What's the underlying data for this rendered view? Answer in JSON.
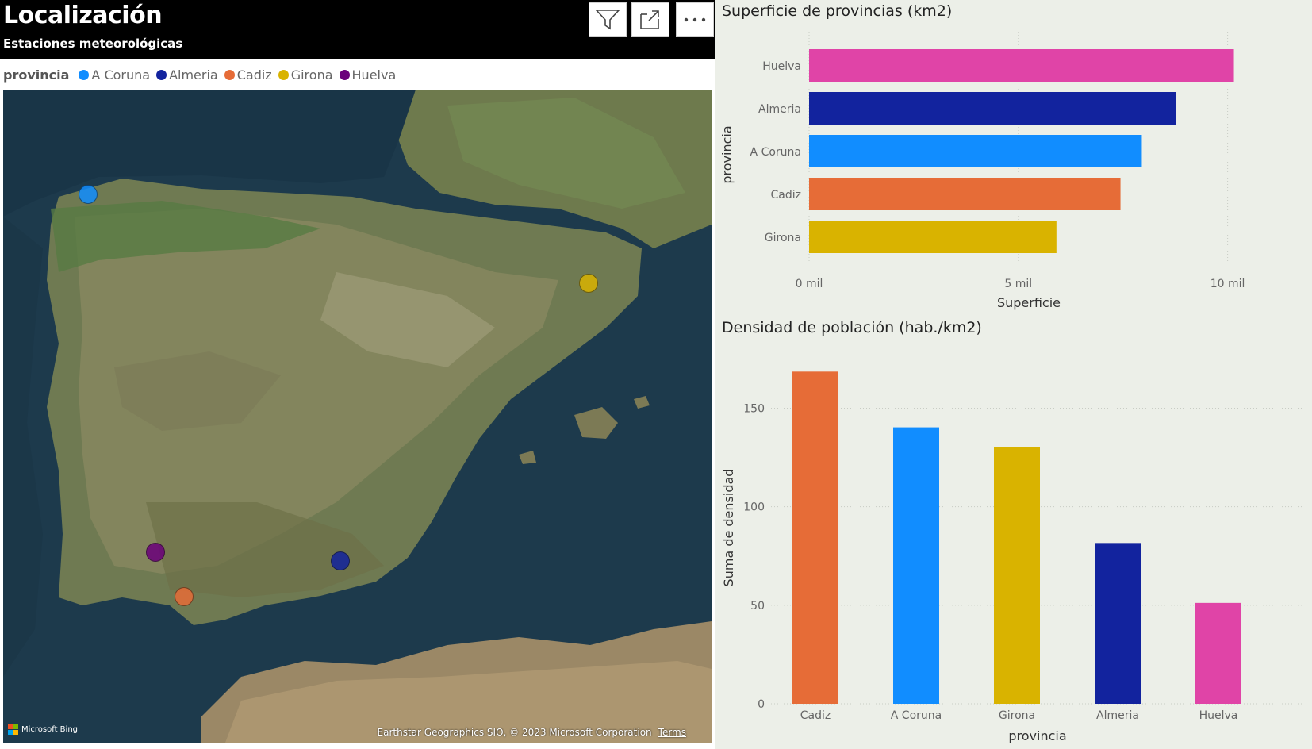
{
  "map_visual": {
    "title": "Localización",
    "subtitle": "Estaciones meteorológicas",
    "toolbar": {
      "filter_icon": "filter-icon",
      "focus_icon": "focus-mode-icon",
      "more_icon": "more-options-icon"
    },
    "legend": {
      "title": "provincia",
      "items": [
        {
          "label": "A Coruna",
          "color": "#118dff"
        },
        {
          "label": "Almeria",
          "color": "#12239e"
        },
        {
          "label": "Cadiz",
          "color": "#e66c37"
        },
        {
          "label": "Girona",
          "color": "#d9b300"
        },
        {
          "label": "Huelva",
          "color": "#6b007b"
        }
      ]
    },
    "markers": [
      {
        "provincia": "A Coruna",
        "color": "#118dff"
      },
      {
        "provincia": "Girona",
        "color": "#d9b300"
      },
      {
        "provincia": "Huelva",
        "color": "#6b007b"
      },
      {
        "provincia": "Cadiz",
        "color": "#e66c37"
      },
      {
        "provincia": "Almeria",
        "color": "#12239e"
      }
    ],
    "logo_text": "Microsoft Bing",
    "attribution": "Earthstar Geographics SIO, © 2023 Microsoft Corporation",
    "terms_link": "Terms"
  },
  "chart_data": [
    {
      "type": "bar",
      "orientation": "horizontal",
      "title": "Superficie de provincias (km2)",
      "categories": [
        "Huelva",
        "Almeria",
        "A Coruna",
        "Cadiz",
        "Girona"
      ],
      "values": [
        10150,
        8775,
        7950,
        7440,
        5910
      ],
      "colors": [
        "#e044a7",
        "#12239e",
        "#118dff",
        "#e66c37",
        "#d9b300"
      ],
      "xlabel": "Superficie",
      "ylabel": "provincia",
      "xlim": [
        0,
        10500
      ],
      "xticks": [
        0,
        5000,
        10000
      ],
      "xtick_labels": [
        "0 mil",
        "5 mil",
        "10 mil"
      ],
      "grid": true
    },
    {
      "type": "bar",
      "orientation": "vertical",
      "title": "Densidad de población (hab./km2)",
      "categories": [
        "Cadiz",
        "A Coruna",
        "Girona",
        "Almeria",
        "Huelva"
      ],
      "values": [
        168.6,
        140.3,
        130.2,
        81.6,
        51.2
      ],
      "colors": [
        "#e66c37",
        "#118dff",
        "#d9b300",
        "#12239e",
        "#e044a7"
      ],
      "xlabel": "provincia",
      "ylabel": "Suma de densidad",
      "ylim": [
        0,
        180
      ],
      "yticks": [
        0,
        50,
        100,
        150
      ],
      "grid": true
    }
  ]
}
